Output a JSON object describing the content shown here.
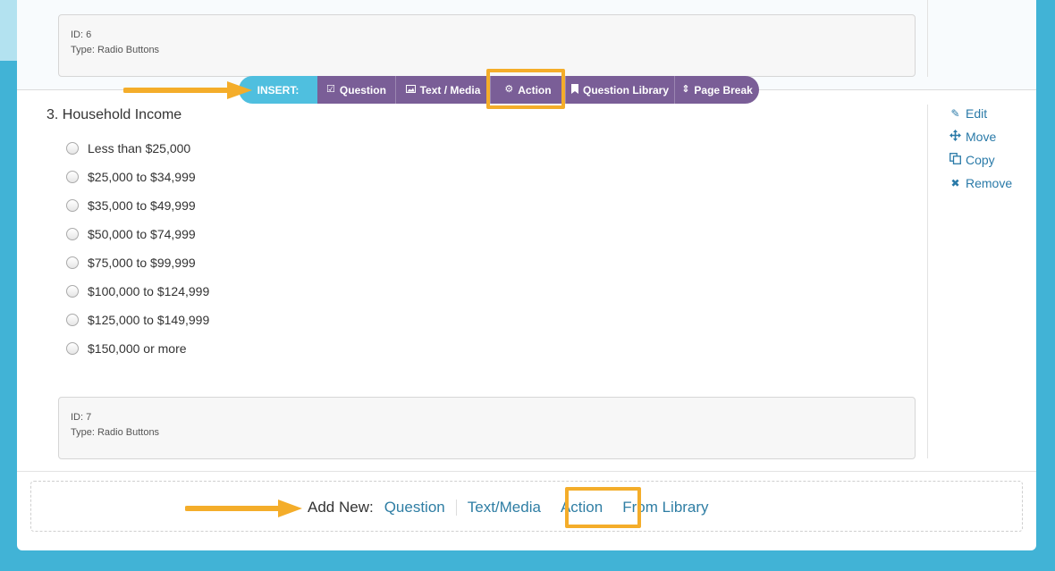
{
  "colors": {
    "background": "#41b3d6",
    "toolbar_purple": "#7a5e97",
    "insert_blue": "#4fbfdf",
    "highlight": "#f4ad2a",
    "link": "#2a7aa8"
  },
  "previous_question": {
    "id_label": "ID: 6",
    "type_label": "Type: Radio Buttons"
  },
  "insert_toolbar": {
    "label": "INSERT:",
    "items": [
      {
        "label": "Question",
        "icon": "check-square-icon"
      },
      {
        "label": "Text / Media",
        "icon": "image-icon"
      },
      {
        "label": "Action",
        "icon": "gear-icon"
      },
      {
        "label": "Question Library",
        "icon": "bookmark-icon"
      },
      {
        "label": "Page Break",
        "icon": "sort-icon"
      }
    ]
  },
  "question": {
    "title": "3. Household Income",
    "options": [
      "Less than $25,000",
      "$25,000 to $34,999",
      "$35,000 to $49,999",
      "$50,000 to $74,999",
      "$75,000 to $99,999",
      "$100,000 to $124,999",
      "$125,000 to $149,999",
      "$150,000 or more"
    ],
    "id_label": "ID: 7",
    "type_label": "Type: Radio Buttons"
  },
  "question_actions": [
    {
      "label": "Edit",
      "icon": "pencil-icon"
    },
    {
      "label": "Move",
      "icon": "move-icon"
    },
    {
      "label": "Copy",
      "icon": "copy-icon"
    },
    {
      "label": "Remove",
      "icon": "remove-icon"
    }
  ],
  "add_new": {
    "label": "Add New:",
    "links": [
      "Question",
      "Text/Media",
      "Action",
      "From Library"
    ]
  }
}
